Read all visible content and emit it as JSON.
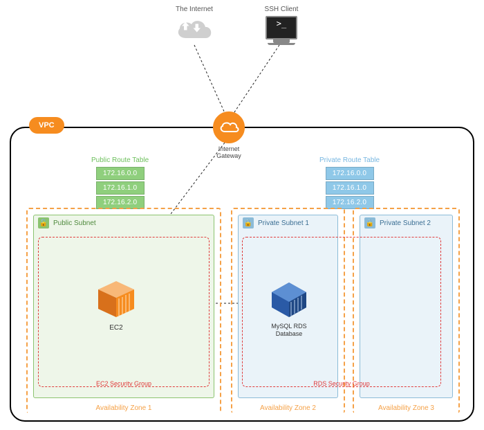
{
  "external": {
    "internet": {
      "label": "The Internet"
    },
    "ssh": {
      "label": "SSH Client",
      "prompt": ">_"
    }
  },
  "gateway": {
    "label": "Internet\nGateway"
  },
  "vpc": {
    "tag": "VPC"
  },
  "route_tables": {
    "public": {
      "title": "Public Route Table",
      "routes": [
        "172.16.0.0",
        "172.16.1.0",
        "172.16.2.0"
      ]
    },
    "private": {
      "title": "Private Route Table",
      "routes": [
        "172.16.0.0",
        "172.16.1.0",
        "172.16.2.0"
      ]
    }
  },
  "zones": {
    "az1": {
      "label": "Availability Zone 1"
    },
    "az2": {
      "label": "Availability Zone 2"
    },
    "az3": {
      "label": "Availability Zone 3"
    }
  },
  "subnets": {
    "public": {
      "title": "Public Subnet"
    },
    "private1": {
      "title": "Private Subnet 1"
    },
    "private2": {
      "title": "Private Subnet 2"
    }
  },
  "security_groups": {
    "ec2": {
      "label": "EC2 Security Group"
    },
    "rds": {
      "label": "RDS Security Group"
    }
  },
  "services": {
    "ec2": {
      "label": "EC2"
    },
    "rds": {
      "label": "MySQL RDS\nDatabase"
    }
  },
  "colors": {
    "aws_orange": "#f68c1f",
    "public_green": "#8bc36f",
    "private_blue": "#8bbbd8",
    "sg_red": "#e03b3b",
    "rds_blue": "#2a5aa6"
  }
}
